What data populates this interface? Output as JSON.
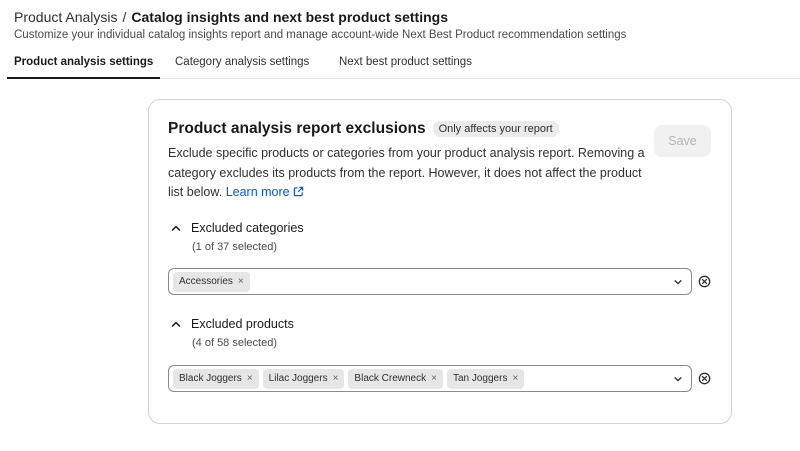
{
  "header": {
    "breadcrumb_parent": "Product Analysis",
    "separator": "/",
    "current": "Catalog insights and next best product settings",
    "subtitle": "Customize your individual catalog insights report and manage account-wide Next Best Product recommendation settings"
  },
  "tabs": [
    {
      "label": "Product analysis settings",
      "active": true
    },
    {
      "label": "Category analysis settings",
      "active": false
    },
    {
      "label": "Next best product settings",
      "active": false
    }
  ],
  "card": {
    "title": "Product analysis report exclusions",
    "badge": "Only affects your report",
    "save_label": "Save",
    "description": "Exclude specific products or categories from your product analysis report. Removing a category excludes its products from the report. However, it does not affect the product list below.",
    "learn_more": "Learn more"
  },
  "categories": {
    "title": "Excluded categories",
    "count": "(1 of 37 selected)",
    "tags": [
      "Accessories"
    ]
  },
  "products": {
    "title": "Excluded products",
    "count": "(4 of 58 selected)",
    "tags": [
      "Black Joggers",
      "Lilac Joggers",
      "Black Crewneck",
      "Tan Joggers"
    ]
  },
  "icons": {
    "tag_remove": "×",
    "external_link": "external-link-icon",
    "collapse": "chevron-up-icon",
    "dropdown": "chevron-down-icon",
    "clear": "circle-x-icon"
  },
  "colors": {
    "link": "#005bd3",
    "tag_bg": "#e6e6e6",
    "save_disabled_bg": "#f1f1f1"
  }
}
